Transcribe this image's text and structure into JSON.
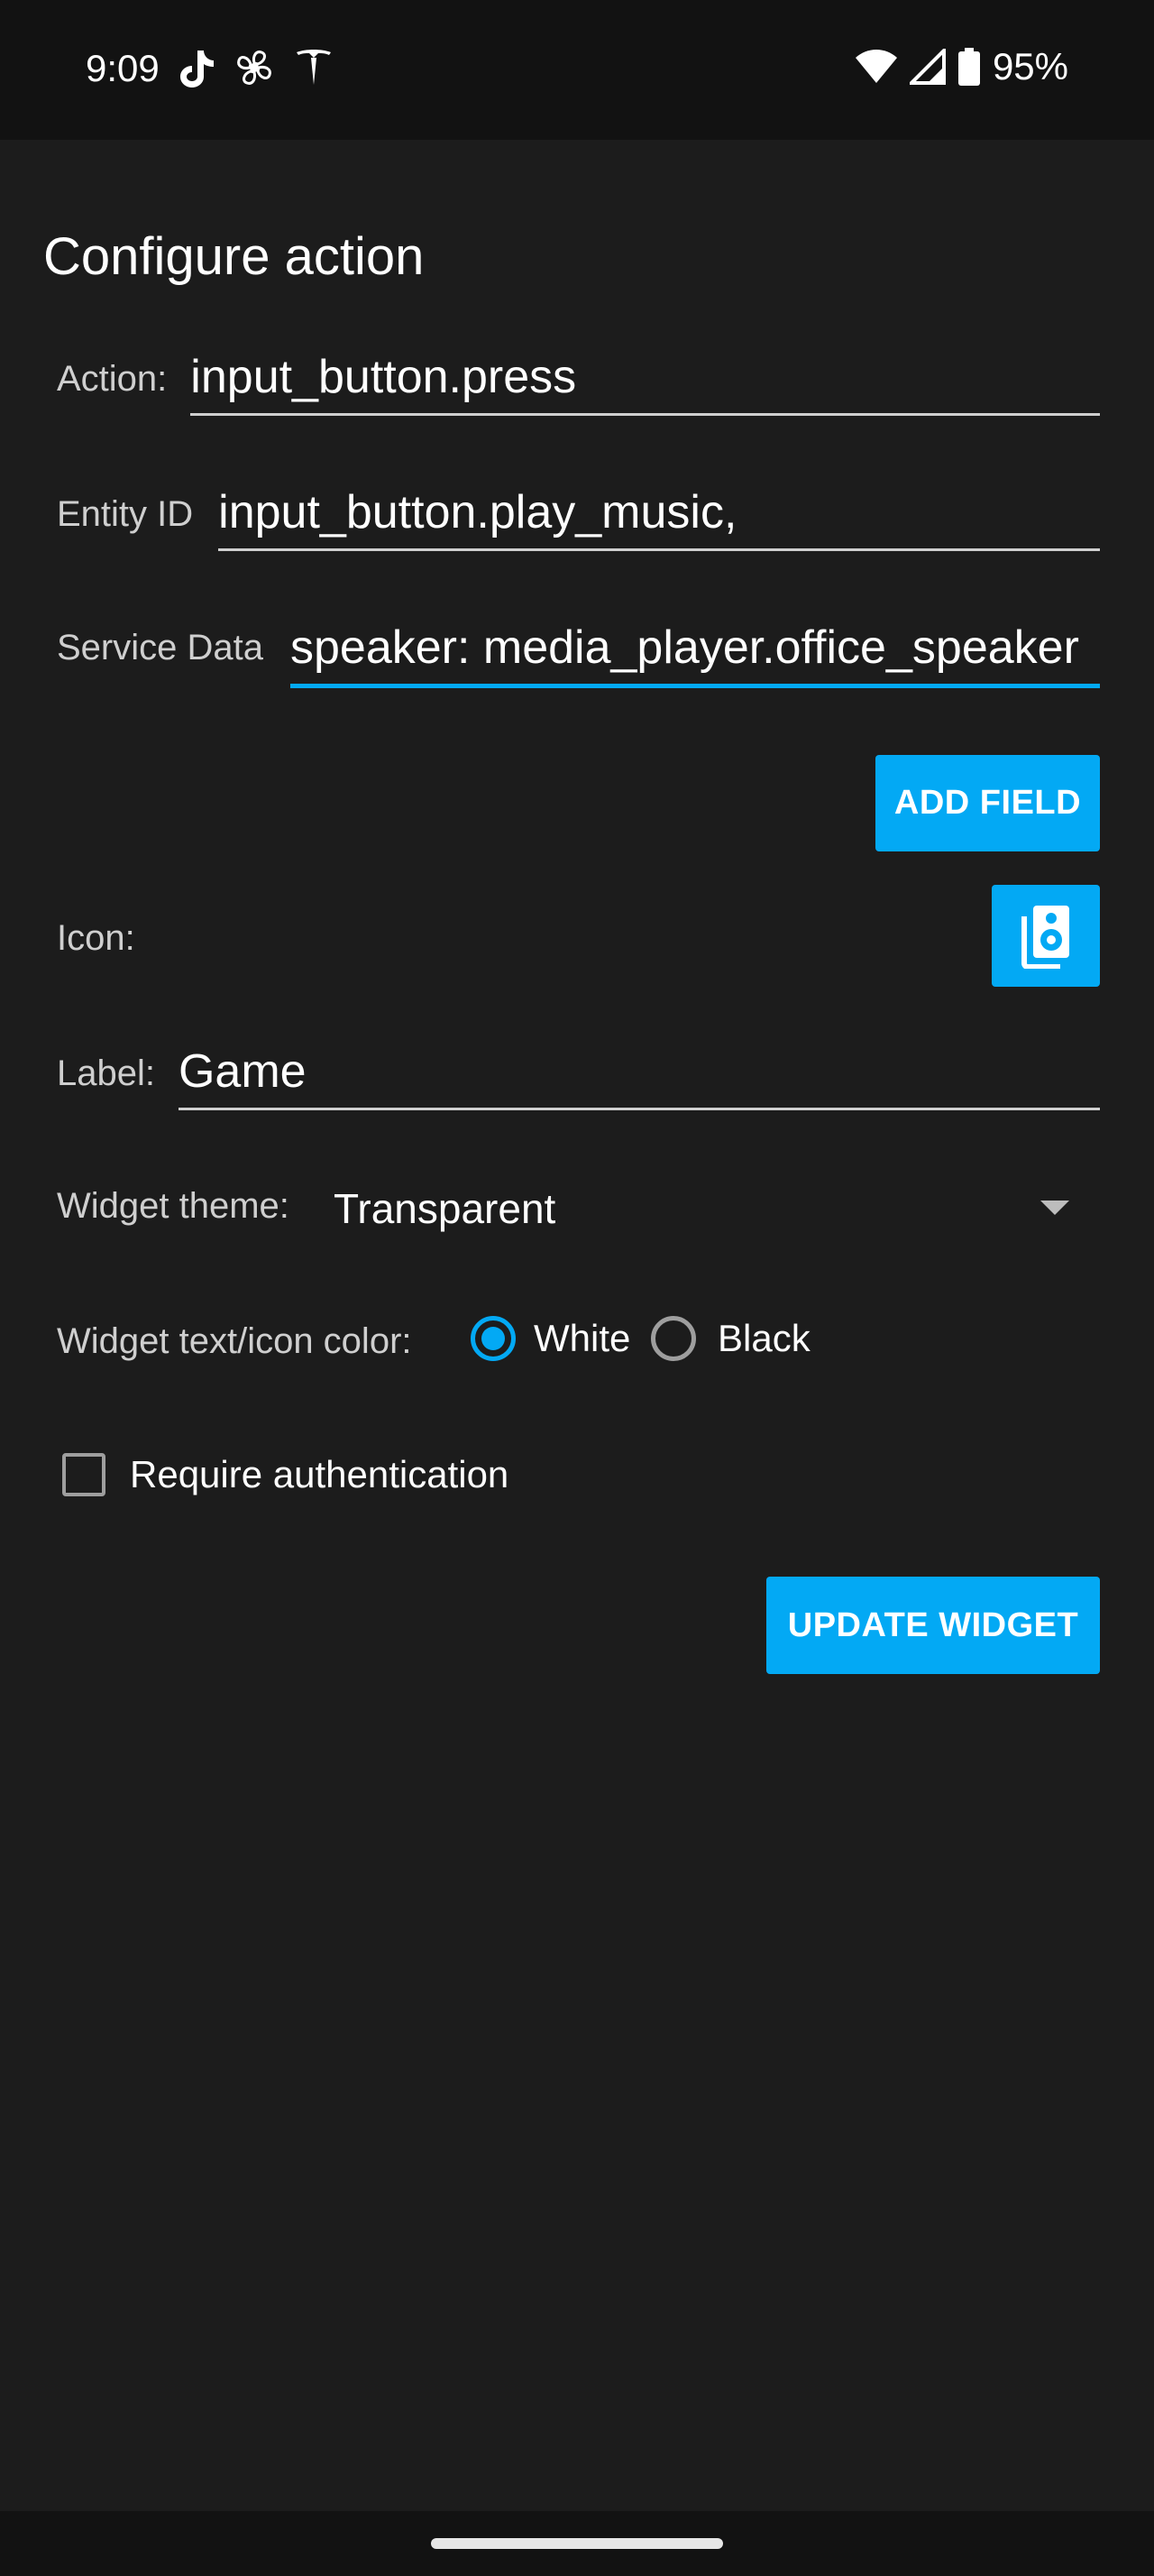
{
  "status_bar": {
    "time": "9:09",
    "battery": "95%",
    "left_icons": [
      "tiktok-icon",
      "fan-icon",
      "tesla-icon"
    ],
    "right_icons": [
      "wifi-icon",
      "signal-icon",
      "battery-icon"
    ]
  },
  "page": {
    "title": "Configure action"
  },
  "form": {
    "action": {
      "label": "Action:",
      "value": "input_button.press"
    },
    "entity": {
      "label": "Entity ID",
      "value": "input_button.play_music,"
    },
    "service_data": {
      "label": "Service Data",
      "value": "speaker: media_player.office_speaker"
    },
    "add_field_button": "ADD FIELD",
    "icon": {
      "label": "Icon:",
      "icon_name": "speaker-icon"
    },
    "label_field": {
      "label": "Label:",
      "value": "Game"
    },
    "widget_theme": {
      "label": "Widget theme:",
      "value": "Transparent"
    },
    "text_color": {
      "label": "Widget text/icon color:",
      "options": [
        "White",
        "Black"
      ],
      "selected": "White"
    },
    "require_auth": {
      "label": "Require authentication",
      "checked": false
    },
    "update_button": "UPDATE WIDGET"
  },
  "colors": {
    "accent": "#03a9f4",
    "background": "#1c1c1c",
    "status_bar": "#121212"
  }
}
